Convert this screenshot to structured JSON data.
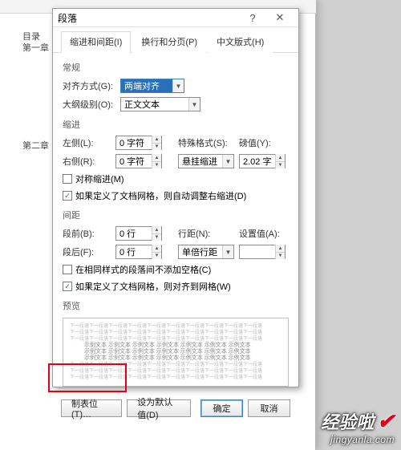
{
  "bg_labels": {
    "toc": "目录",
    "ch1": "第一章",
    "ch2": "第二章"
  },
  "dialog": {
    "title": "段落",
    "tabs": [
      "缩进和间距(I)",
      "换行和分页(P)",
      "中文版式(H)"
    ],
    "section_general": "常规",
    "align_label": "对齐方式(G):",
    "align_value": "两端对齐",
    "outline_label": "大纲级别(O):",
    "outline_value": "正文文本",
    "section_indent": "缩进",
    "left_label": "左侧(L):",
    "left_value": "0 字符",
    "right_label": "右侧(R):",
    "right_value": "0 字符",
    "special_label": "特殊格式(S):",
    "special_value": "悬挂缩进",
    "by_label": "磅值(Y):",
    "by_value": "2.02 字",
    "mirror_chk": "对称缩进(M)",
    "grid_chk1": "如果定义了文档网格，则自动调整右缩进(D)",
    "section_spacing": "间距",
    "before_label": "段前(B):",
    "before_value": "0 行",
    "after_label": "段后(F):",
    "after_value": "0 行",
    "linespace_label": "行距(N):",
    "linespace_value": "单倍行距",
    "at_label": "设置值(A):",
    "at_value": "",
    "samestyle_chk": "在相同样式的段落间不添加空格(C)",
    "grid_chk2": "如果定义了文档网格，则对齐到网格(W)",
    "section_preview": "预览",
    "preview_line_faint": "下一段落下一段落下一段落下一段落下一段落下一段落下一段落下一段落下一段落下一段落",
    "preview_line_main": "示例文本 示例文本 示例文本 示例文本 示例文本 示例文本 示例文本",
    "buttons": {
      "tabs": "制表位(T)…",
      "default": "设为默认值(D)",
      "ok": "确定",
      "cancel": "取消"
    }
  },
  "watermark": {
    "top": "经验啦",
    "bottom": "jingyanla.com"
  }
}
